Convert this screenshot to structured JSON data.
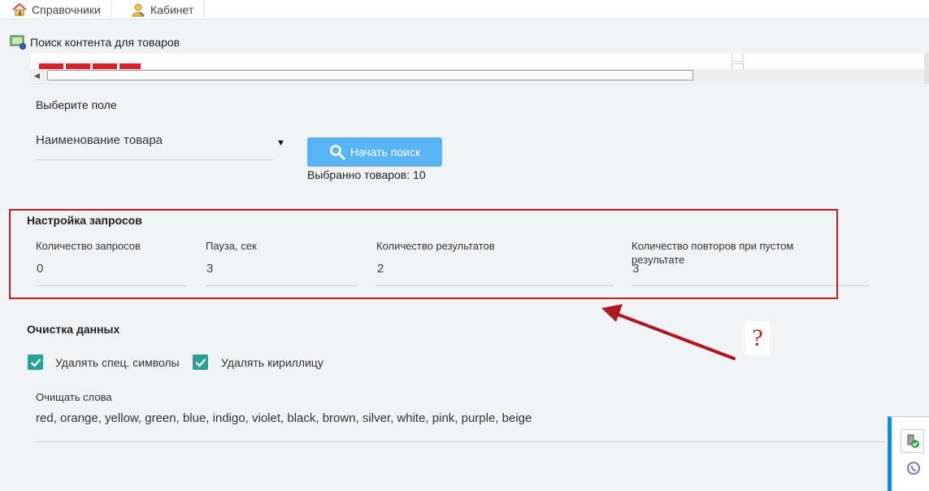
{
  "top_tabs": [
    {
      "label": "Справочники",
      "icon": "home-icon"
    },
    {
      "label": "Кабинет",
      "icon": "user-icon"
    }
  ],
  "panel": {
    "title": "Поиск контента для товаров",
    "icon": "search-content-icon"
  },
  "search": {
    "field_label": "Выберите поле",
    "field_value": "Наименование товара",
    "button_label": "Начать поиск",
    "selected_count": "Выбранно товаров: 10"
  },
  "requests": {
    "title": "Настройка запросов",
    "fields": [
      {
        "label": "Количество запросов",
        "value": "0"
      },
      {
        "label": "Пауза, сек",
        "value": "3"
      },
      {
        "label": "Количество результатов",
        "value": "2"
      },
      {
        "label": "Количество повторов при пустом результате",
        "value": "3"
      }
    ]
  },
  "cleanup": {
    "title": "Очистка данных",
    "checkboxes": [
      {
        "label": "Удалять спец. символы",
        "checked": true
      },
      {
        "label": "Удалять кириллицу",
        "checked": true
      }
    ],
    "words_label": "Очищать слова",
    "words_value": "red, orange, yellow, green, blue, indigo, violet, black, brown, silver, white, pink, purple, beige"
  },
  "annotation": {
    "text": "?",
    "color": "#c21c24"
  },
  "colors": {
    "accent": "#58b4f5",
    "checkbox": "#2aa197",
    "annotation": "#c21c24"
  }
}
